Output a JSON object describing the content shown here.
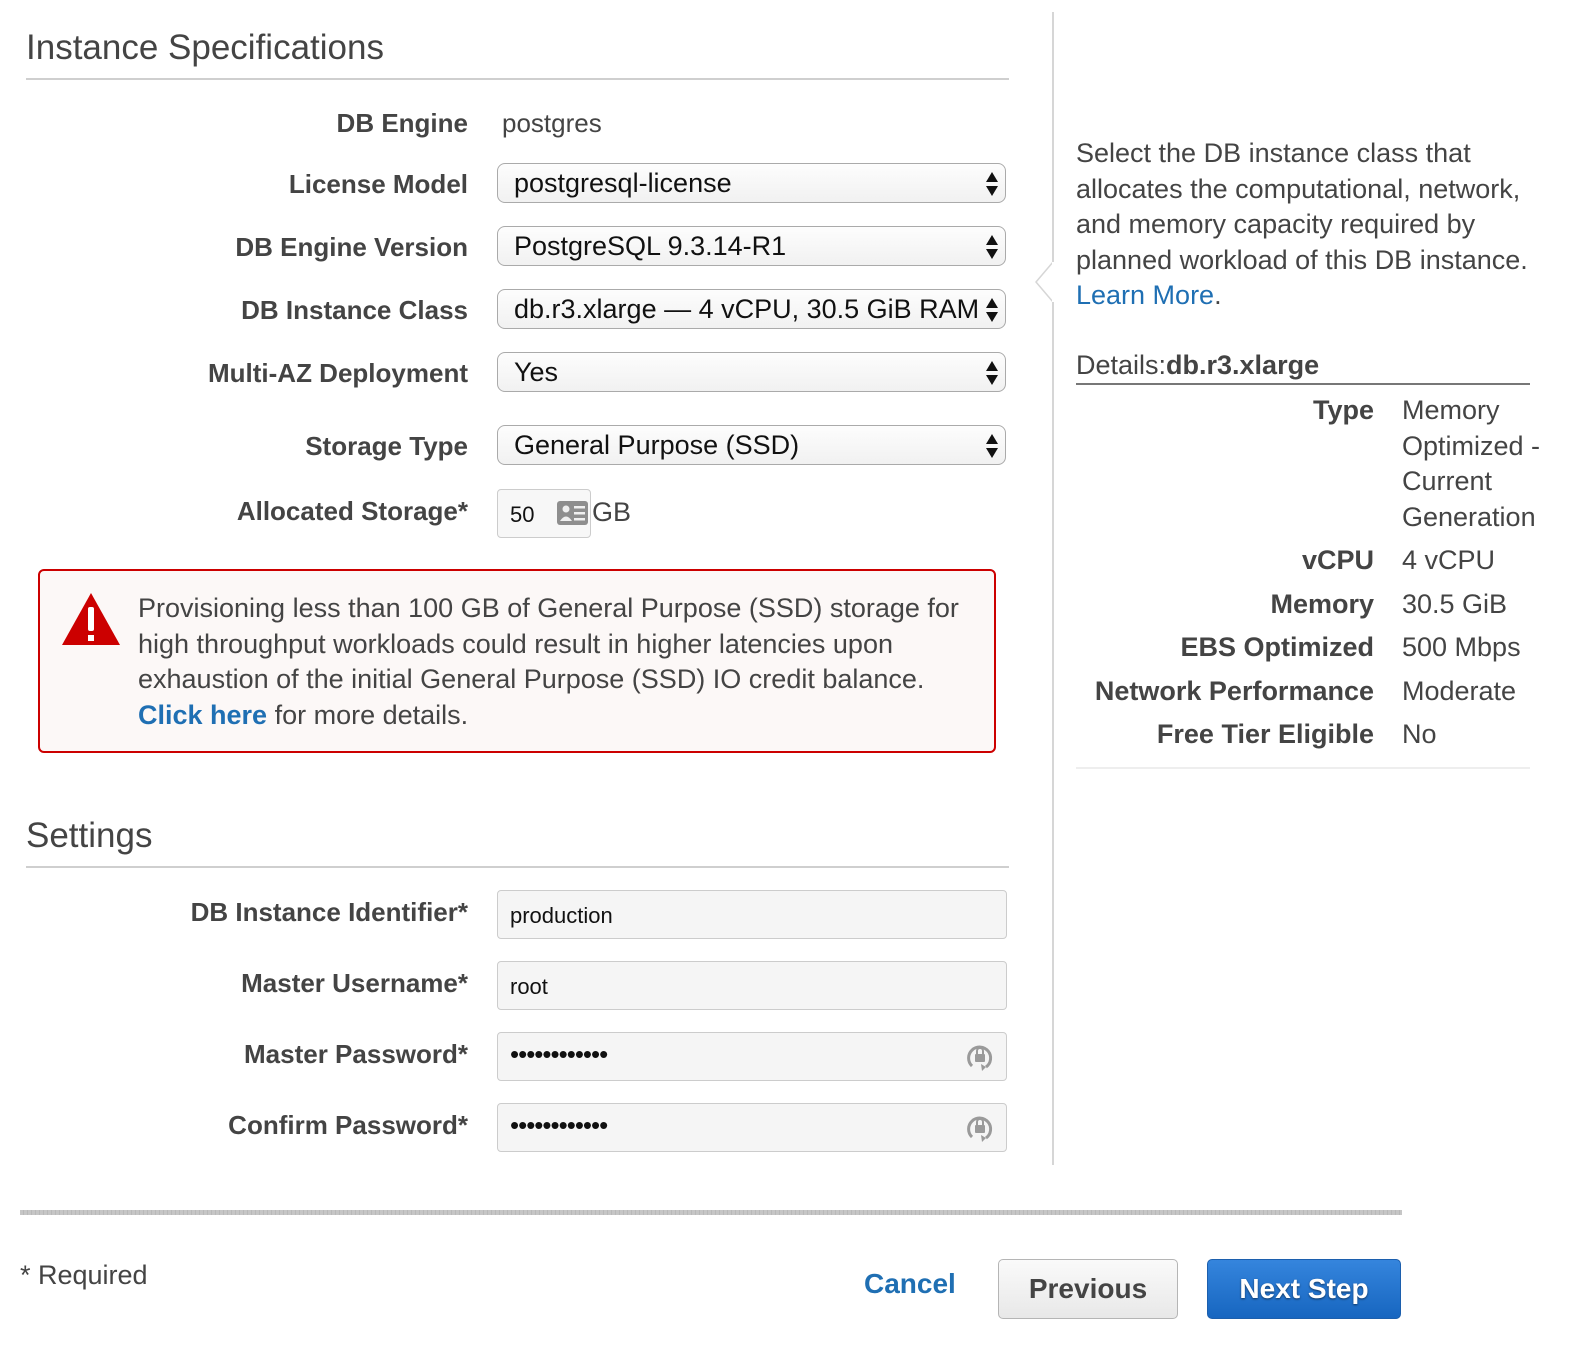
{
  "instance_specifications": {
    "title": "Instance Specifications",
    "db_engine": {
      "label": "DB Engine",
      "value": "postgres"
    },
    "license_model": {
      "label": "License Model",
      "value": "postgresql-license"
    },
    "db_engine_version": {
      "label": "DB Engine Version",
      "value": "PostgreSQL 9.3.14-R1"
    },
    "db_instance_class": {
      "label": "DB Instance Class",
      "value": "db.r3.xlarge — 4 vCPU, 30.5 GiB RAM"
    },
    "multi_az": {
      "label": "Multi-AZ Deployment",
      "value": "Yes"
    },
    "storage_type": {
      "label": "Storage Type",
      "value": "General Purpose (SSD)"
    },
    "allocated_storage": {
      "label": "Allocated Storage*",
      "value": "50",
      "unit": "GB"
    }
  },
  "warning": {
    "message": "Provisioning less than 100 GB of General Purpose (SSD) storage for high throughput workloads could result in higher latencies upon exhaustion of the initial General Purpose (SSD) IO credit balance.",
    "link_text": "Click here",
    "suffix": " for more details.",
    "icon": "warning-triangle-icon",
    "color": "#cc0000"
  },
  "settings": {
    "title": "Settings",
    "db_instance_identifier": {
      "label": "DB Instance Identifier*",
      "value": "production"
    },
    "master_username": {
      "label": "Master Username*",
      "value": "root"
    },
    "master_password": {
      "label": "Master Password*",
      "value": "••••••••••••"
    },
    "confirm_password": {
      "label": "Confirm Password*",
      "value": "••••••••••••"
    }
  },
  "help_panel": {
    "text": "Select the DB instance class that allocates the computational, network, and memory capacity required by planned workload of this DB instance.",
    "link_text": "Learn More",
    "link_suffix": ".",
    "details_prefix": "Details:",
    "details_class": "db.r3.xlarge",
    "details": [
      {
        "label": "Type",
        "value": "Memory Optimized - Current Generation"
      },
      {
        "label": "vCPU",
        "value": "4 vCPU"
      },
      {
        "label": "Memory",
        "value": "30.5 GiB"
      },
      {
        "label": "EBS Optimized",
        "value": "500 Mbps"
      },
      {
        "label": "Network Performance",
        "value": "Moderate"
      },
      {
        "label": "Free Tier Eligible",
        "value": "No"
      }
    ]
  },
  "footer": {
    "required_note": "* Required",
    "cancel_label": "Cancel",
    "previous_label": "Previous",
    "next_label": "Next Step"
  },
  "colors": {
    "link": "#1f6fb3",
    "primary_button": "#1766c0",
    "alert_border": "#cc0000"
  }
}
